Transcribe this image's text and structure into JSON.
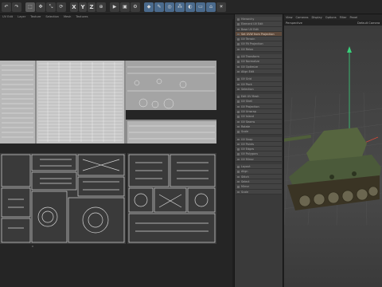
{
  "toolbar": {
    "icons": [
      "undo-icon",
      "redo-icon",
      "live-select-icon",
      "move-icon",
      "scale-icon",
      "rotate-icon",
      "axis-x",
      "axis-y",
      "axis-z",
      "coordinate-system-icon",
      "render-view-icon",
      "render-picture-icon",
      "render-settings-icon",
      "cube-icon",
      "pen-icon",
      "subdivision-icon",
      "array-icon",
      "deformer-icon",
      "floor-icon",
      "camera-icon",
      "light-icon"
    ],
    "axis_labels": [
      "X",
      "Y",
      "Z"
    ]
  },
  "uv_editor": {
    "menu": [
      "UV Edit",
      "Layer",
      "Texture",
      "Selection",
      "Mesh",
      "Textures"
    ]
  },
  "object_panel": {
    "items": [
      {
        "label": "Hierarchy",
        "highlight": false
      },
      {
        "label": "Element UV Edit",
        "highlight": false
      },
      {
        "label": "Base UV Edit",
        "highlight": false
      },
      {
        "label": "Set UVW from Projection",
        "highlight": true
      },
      {
        "label": "UV Terrain",
        "highlight": false
      },
      {
        "label": "UV Fit Projection",
        "highlight": false
      },
      {
        "label": "UV Relax",
        "highlight": false
      },
      {
        "label": "UV Transform",
        "highlight": false
      },
      {
        "label": "UV Normalize",
        "highlight": false
      },
      {
        "label": "UV Optimize",
        "highlight": false
      },
      {
        "label": "Align Edit",
        "highlight": false
      },
      {
        "label": "UV Grid",
        "highlight": false
      },
      {
        "label": "UV Pack",
        "highlight": false
      },
      {
        "label": "Selection",
        "highlight": false
      },
      {
        "label": "Edit UV Mesh",
        "highlight": false
      },
      {
        "label": "UV Shell",
        "highlight": false
      },
      {
        "label": "UV Projection",
        "highlight": false
      },
      {
        "label": "UV Unwrap",
        "highlight": false
      },
      {
        "label": "UV Island",
        "highlight": false
      },
      {
        "label": "UV Seams",
        "highlight": false
      },
      {
        "label": "Rotate",
        "highlight": false
      },
      {
        "label": "Scale",
        "highlight": false
      },
      {
        "label": "UV Snap",
        "highlight": false
      },
      {
        "label": "UV Points",
        "highlight": false
      },
      {
        "label": "UV Edges",
        "highlight": false
      },
      {
        "label": "UV Polygons",
        "highlight": false
      },
      {
        "label": "UV Mirror",
        "highlight": false
      },
      {
        "label": "Layout",
        "highlight": false
      },
      {
        "label": "Align",
        "highlight": false
      },
      {
        "label": "Stitch",
        "highlight": false
      },
      {
        "label": "Select",
        "highlight": false
      },
      {
        "label": "Mirror",
        "highlight": false
      },
      {
        "label": "Scale",
        "highlight": false
      }
    ]
  },
  "viewport": {
    "menu": [
      "View",
      "Cameras",
      "Display",
      "Options",
      "Filter",
      "Panel"
    ],
    "label": "Perspective",
    "camera": "Default Camera"
  },
  "colors": {
    "accent_highlight": "#5e4a3c",
    "tank_body": "#4b5a3a",
    "axis_y": "#39d07a",
    "axis_x": "#d04a3a",
    "uv_lines": "#d4d4d4"
  }
}
